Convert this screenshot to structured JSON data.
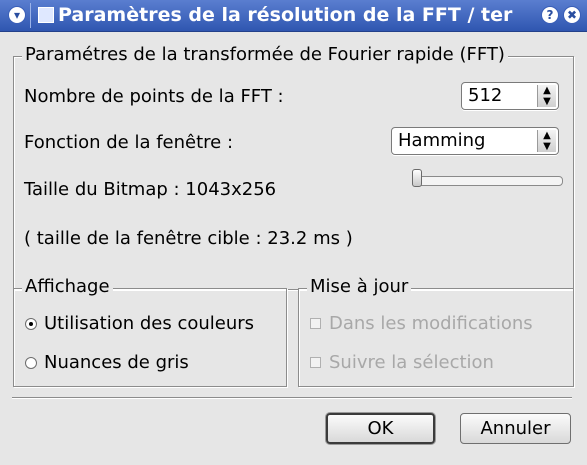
{
  "window": {
    "title": "Paramètres de la résolution de la FFT / ter",
    "menu_icon": "chevron-down-icon",
    "app_icon": "app-icon",
    "help_label": "?",
    "close_label": "✖"
  },
  "fft_group": {
    "title": "Paramétres de la transformée de Fourier rapide (FFT)",
    "points_label": "Nombre de points de la FFT :",
    "points_value": "512",
    "window_label": "Fonction de la fenêtre :",
    "window_value": "Hamming",
    "bitmap_size_text": "Taille du Bitmap : 1043x256",
    "target_size_text": "( taille de la fenêtre cible : 23.2 ms )",
    "slider_level": 0.0
  },
  "display_group": {
    "title": "Affichage",
    "options": [
      {
        "label": "Utilisation des couleurs",
        "selected": true
      },
      {
        "label": "Nuances de gris",
        "selected": false
      }
    ]
  },
  "update_group": {
    "title": "Mise à jour",
    "options": [
      {
        "label": "Dans les modifications",
        "checked": false,
        "enabled": false
      },
      {
        "label": "Suivre la sélection",
        "checked": false,
        "enabled": false
      }
    ]
  },
  "buttons": {
    "ok_label": "OK",
    "cancel_label": "Annuler"
  }
}
